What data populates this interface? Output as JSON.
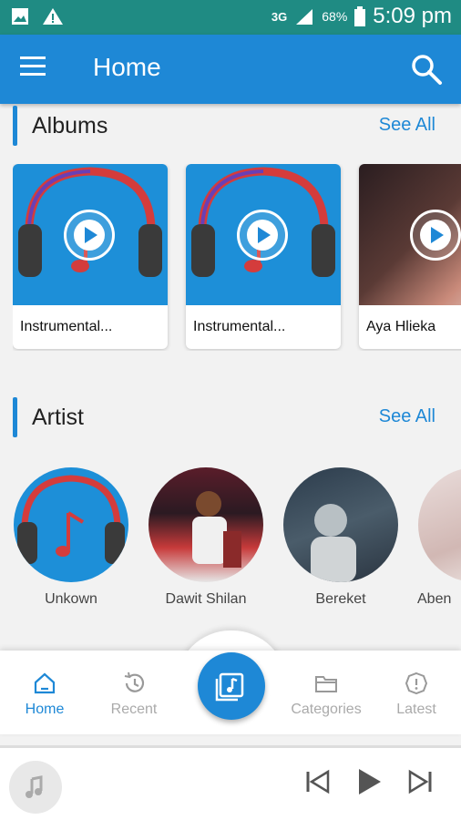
{
  "status_bar": {
    "network": "3G",
    "battery": "68%",
    "time": "5:09 pm"
  },
  "app_bar": {
    "title": "Home"
  },
  "albums": {
    "title": "Albums",
    "see_all": "See All",
    "items": [
      {
        "name": "Instrumental..."
      },
      {
        "name": "Instrumental..."
      },
      {
        "name": "Aya Hlieka"
      }
    ]
  },
  "artists": {
    "title": "Artist",
    "see_all": "See All",
    "items": [
      {
        "name": "Unkown"
      },
      {
        "name": "Dawit Shilan"
      },
      {
        "name": "Bereket"
      },
      {
        "name": "Aben"
      }
    ]
  },
  "bottom_nav": {
    "items": [
      {
        "label": "Home",
        "icon": "home-icon"
      },
      {
        "label": "Recent",
        "icon": "history-icon"
      },
      {
        "label": "Categories",
        "icon": "folder-icon"
      },
      {
        "label": "Latest",
        "icon": "alert-icon"
      }
    ],
    "center_icon": "music-library-icon"
  },
  "player": {
    "icons": [
      "music-note-icon",
      "previous-icon",
      "play-icon",
      "next-icon"
    ]
  },
  "colors": {
    "primary": "#1e88d6",
    "status_bar": "#1f8b83"
  }
}
